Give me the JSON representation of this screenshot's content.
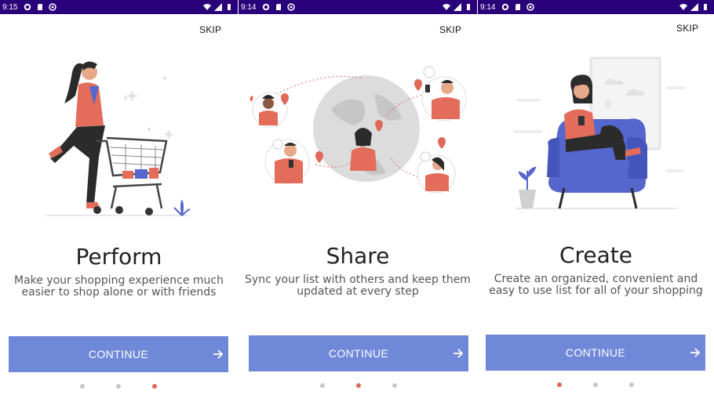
{
  "colors": {
    "statusbar": "#2a007a",
    "accent": "#7088d8",
    "active_dot": "#e0695a",
    "dot": "#c8c8c8"
  },
  "screens": [
    {
      "status_time": "9:15",
      "skip_label": "SKIP",
      "title": "Perform",
      "description_line1": "Make your shopping experience much",
      "description_line2": "easier to shop alone or with friends",
      "cta_label": "CONTINUE",
      "active_page": 3,
      "page_count": 3
    },
    {
      "status_time": "9:14",
      "skip_label": "SKIP",
      "title": "Share",
      "description_line1": "Sync your list with others and keep them",
      "description_line2": "updated at every step",
      "cta_label": "CONTINUE",
      "active_page": 2,
      "page_count": 3
    },
    {
      "status_time": "9:14",
      "skip_label": "SKIP",
      "title": "Create",
      "description_line1": "Create an organized, convenient and",
      "description_line2": "easy to use list for all of your shopping",
      "cta_label": "CONTINUE",
      "active_page": 1,
      "page_count": 3
    }
  ]
}
